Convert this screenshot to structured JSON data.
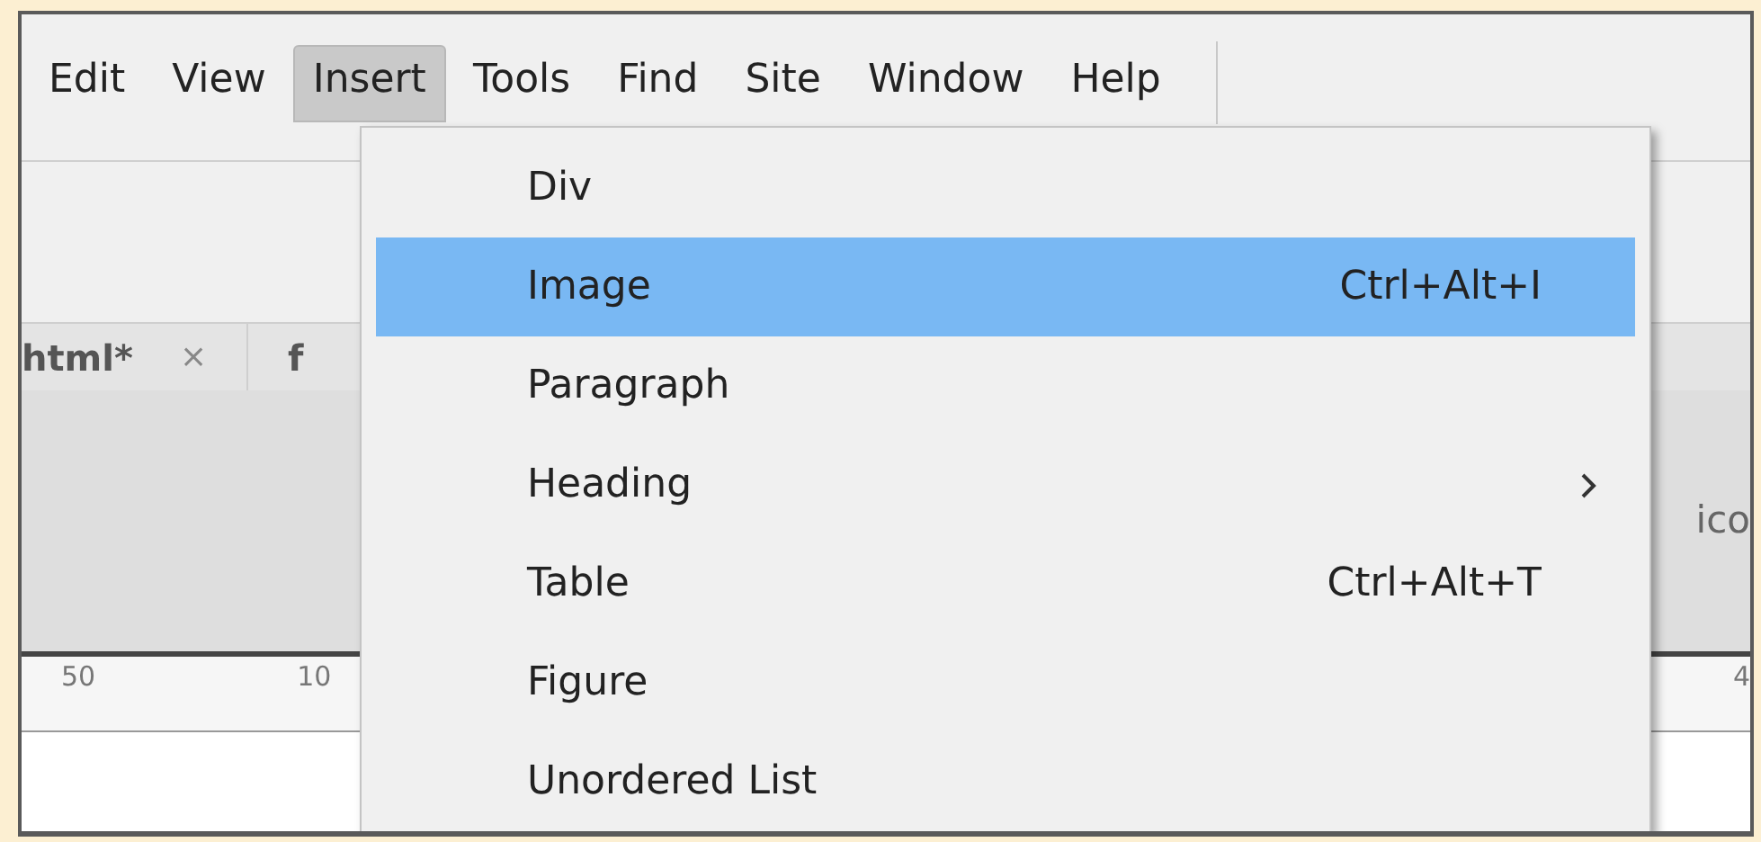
{
  "menu_bar": [
    {
      "label": "Edit",
      "selected": false
    },
    {
      "label": "View",
      "selected": false
    },
    {
      "label": "Insert",
      "selected": true
    },
    {
      "label": "Tools",
      "selected": false
    },
    {
      "label": "Find",
      "selected": false
    },
    {
      "label": "Site",
      "selected": false
    },
    {
      "label": "Window",
      "selected": false
    },
    {
      "label": "Help",
      "selected": false
    }
  ],
  "document_tabs": [
    {
      "label": "html*",
      "close": "×"
    },
    {
      "label": "f"
    }
  ],
  "design_panel": {
    "label": "ico"
  },
  "ruler": {
    "left_labels": [
      "50",
      "10"
    ],
    "right_labels": [
      "4"
    ]
  },
  "insert_menu": [
    {
      "label": "Div",
      "selected": false
    },
    {
      "label": "Image",
      "shortcut": "Ctrl+Alt+I",
      "selected": true
    },
    {
      "label": "Paragraph",
      "selected": false
    },
    {
      "label": "Heading",
      "submenu": true,
      "selected": false
    },
    {
      "label": "Table",
      "shortcut": "Ctrl+Alt+T",
      "selected": false
    },
    {
      "label": "Figure",
      "selected": false
    },
    {
      "label": "Unordered List",
      "selected": false
    }
  ]
}
